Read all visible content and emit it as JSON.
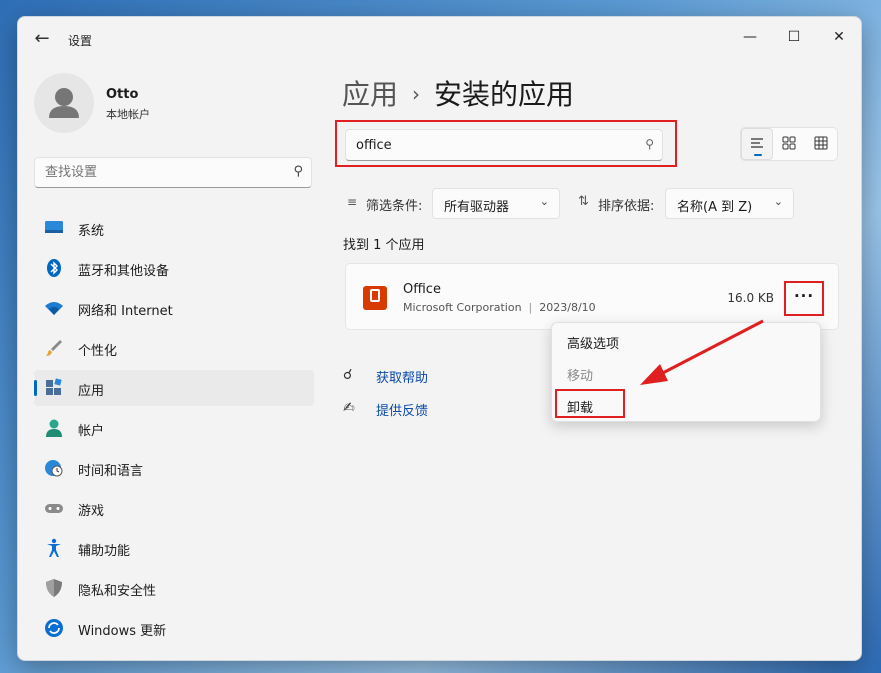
{
  "window": {
    "title": "设置",
    "controls": {
      "minimize": "—",
      "maximize": "☐",
      "close": "✕"
    }
  },
  "profile": {
    "name": "Otto",
    "account_type": "本地帐户"
  },
  "sidebar": {
    "search_placeholder": "查找设置",
    "items": [
      {
        "label": "系统",
        "icon": "monitor-icon"
      },
      {
        "label": "蓝牙和其他设备",
        "icon": "bluetooth-icon"
      },
      {
        "label": "网络和 Internet",
        "icon": "wifi-icon"
      },
      {
        "label": "个性化",
        "icon": "brush-icon"
      },
      {
        "label": "应用",
        "icon": "apps-icon",
        "active": true
      },
      {
        "label": "帐户",
        "icon": "account-icon"
      },
      {
        "label": "时间和语言",
        "icon": "globe-clock-icon"
      },
      {
        "label": "游戏",
        "icon": "gamepad-icon"
      },
      {
        "label": "辅助功能",
        "icon": "accessibility-icon"
      },
      {
        "label": "隐私和安全性",
        "icon": "shield-icon"
      },
      {
        "label": "Windows 更新",
        "icon": "update-icon"
      }
    ]
  },
  "header": {
    "crumb": "应用",
    "separator": "›",
    "title": "安装的应用"
  },
  "app_search": {
    "value": "office"
  },
  "filters": {
    "filter_label": "筛选条件:",
    "drive_value": "所有驱动器",
    "sort_label": "排序依据:",
    "sort_value": "名称(A 到 Z)"
  },
  "results": {
    "count_text": "找到 1 个应用"
  },
  "app": {
    "name": "Office",
    "publisher": "Microsoft Corporation",
    "date": "2023/8/10",
    "size": "16.0 KB",
    "more": "···"
  },
  "context_menu": {
    "items": [
      {
        "label": "高级选项",
        "enabled": true
      },
      {
        "label": "移动",
        "enabled": false
      },
      {
        "label": "卸载",
        "enabled": true
      }
    ]
  },
  "help": {
    "get_help": "获取帮助",
    "feedback": "提供反馈"
  },
  "colors": {
    "accent": "#0067c0",
    "highlight": "#e02020",
    "office": "#d83b01"
  }
}
